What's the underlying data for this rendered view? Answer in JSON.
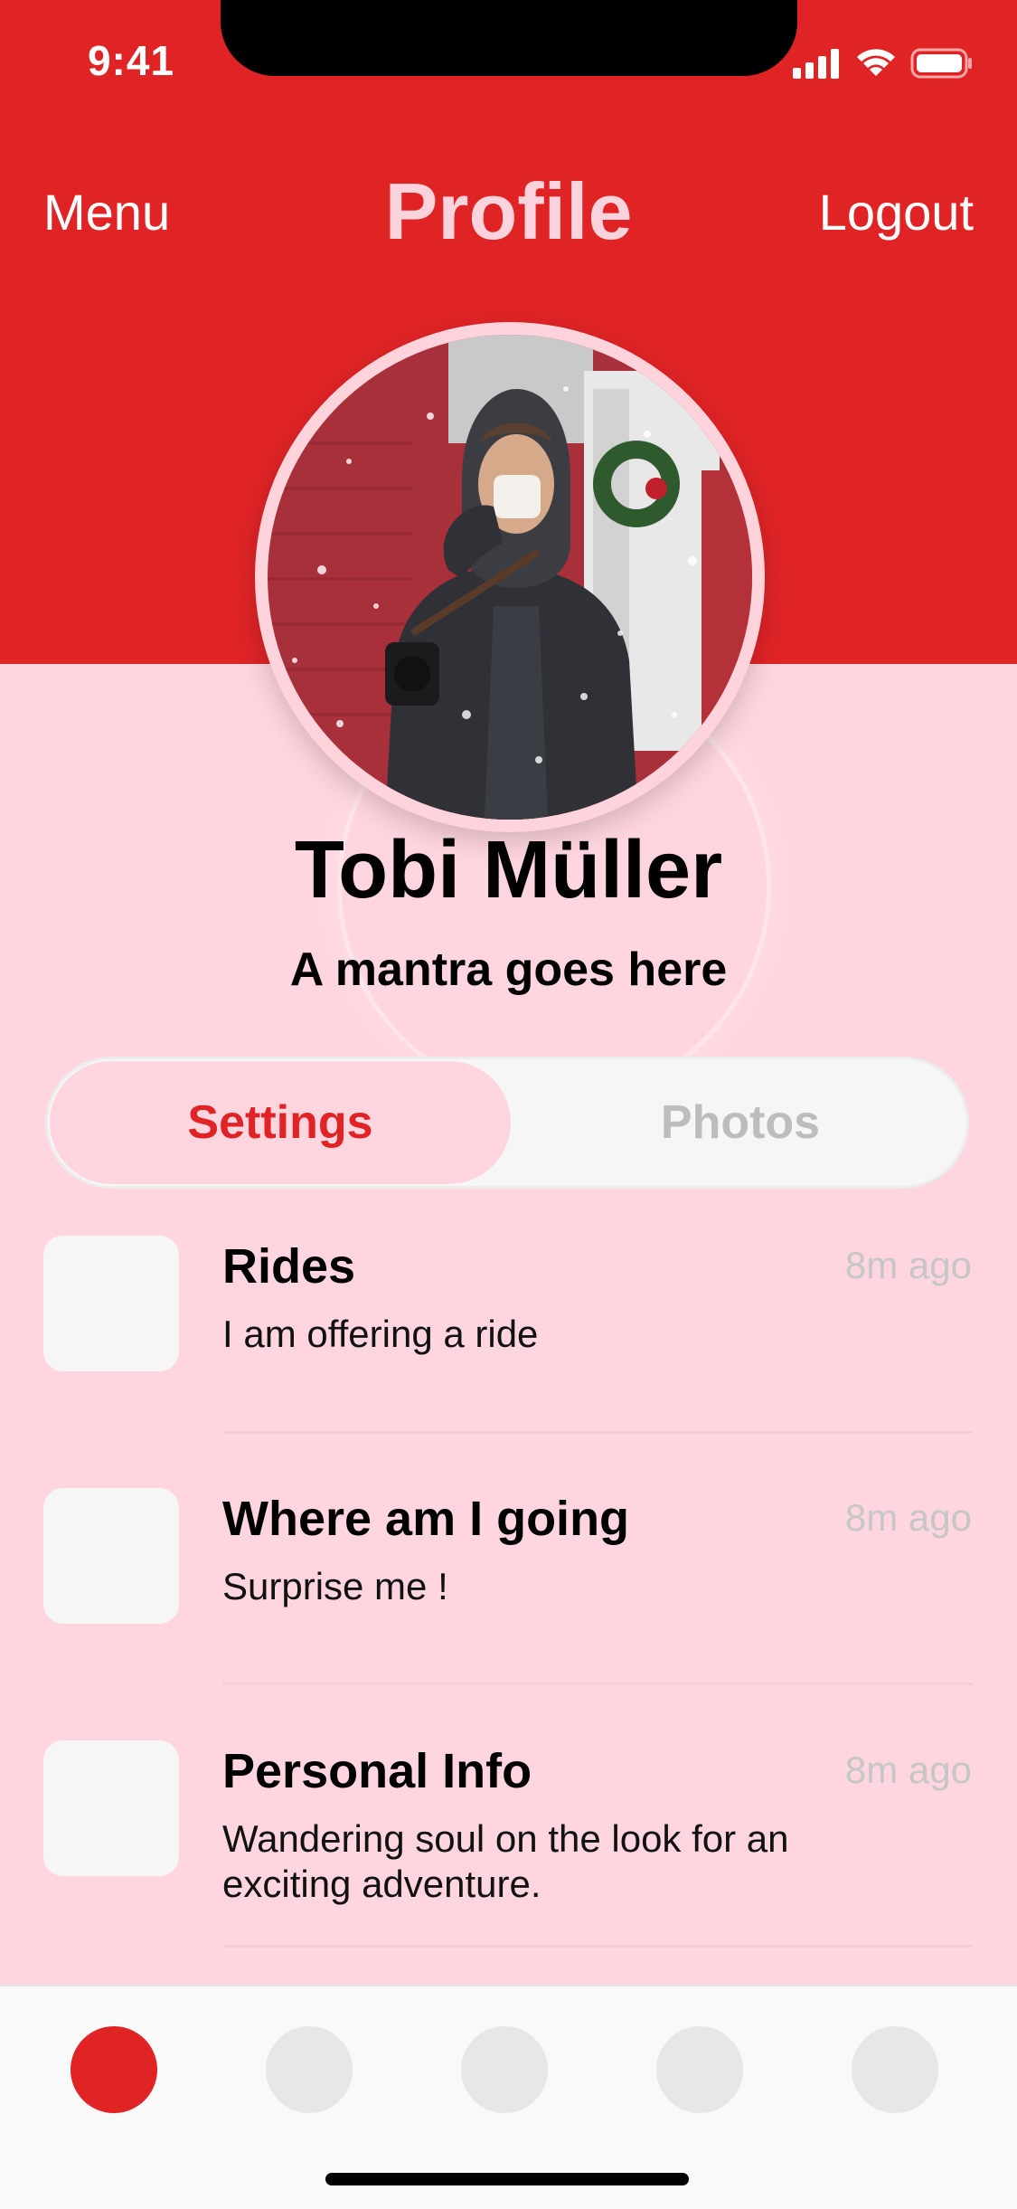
{
  "status_bar": {
    "time": "9:41",
    "icons": [
      "cellular-signal-icon",
      "wifi-icon",
      "battery-icon"
    ]
  },
  "nav": {
    "left": "Menu",
    "title": "Profile",
    "right": "Logout"
  },
  "profile": {
    "name": "Tobi Müller",
    "mantra": "A mantra goes here"
  },
  "segment": {
    "tabs": [
      {
        "label": "Settings",
        "active": true
      },
      {
        "label": "Photos",
        "active": false
      }
    ]
  },
  "feed": {
    "items": [
      {
        "title": "Rides",
        "description": "I am offering a ride",
        "time": "8m ago"
      },
      {
        "title": "Where am I going",
        "description": "Surprise me !",
        "time": "8m ago"
      },
      {
        "title": "Personal Info",
        "description": "Wandering soul on the look for an exciting adventure.",
        "time": "8m ago"
      }
    ]
  },
  "tab_bar": {
    "items": [
      "tab-1",
      "tab-2",
      "tab-3",
      "tab-4",
      "tab-5"
    ],
    "active_index": 0
  },
  "colors": {
    "primary": "#e02426",
    "background": "#ffd6df",
    "surface": "#f6f6f6",
    "muted_text": "#bdbdbd"
  }
}
